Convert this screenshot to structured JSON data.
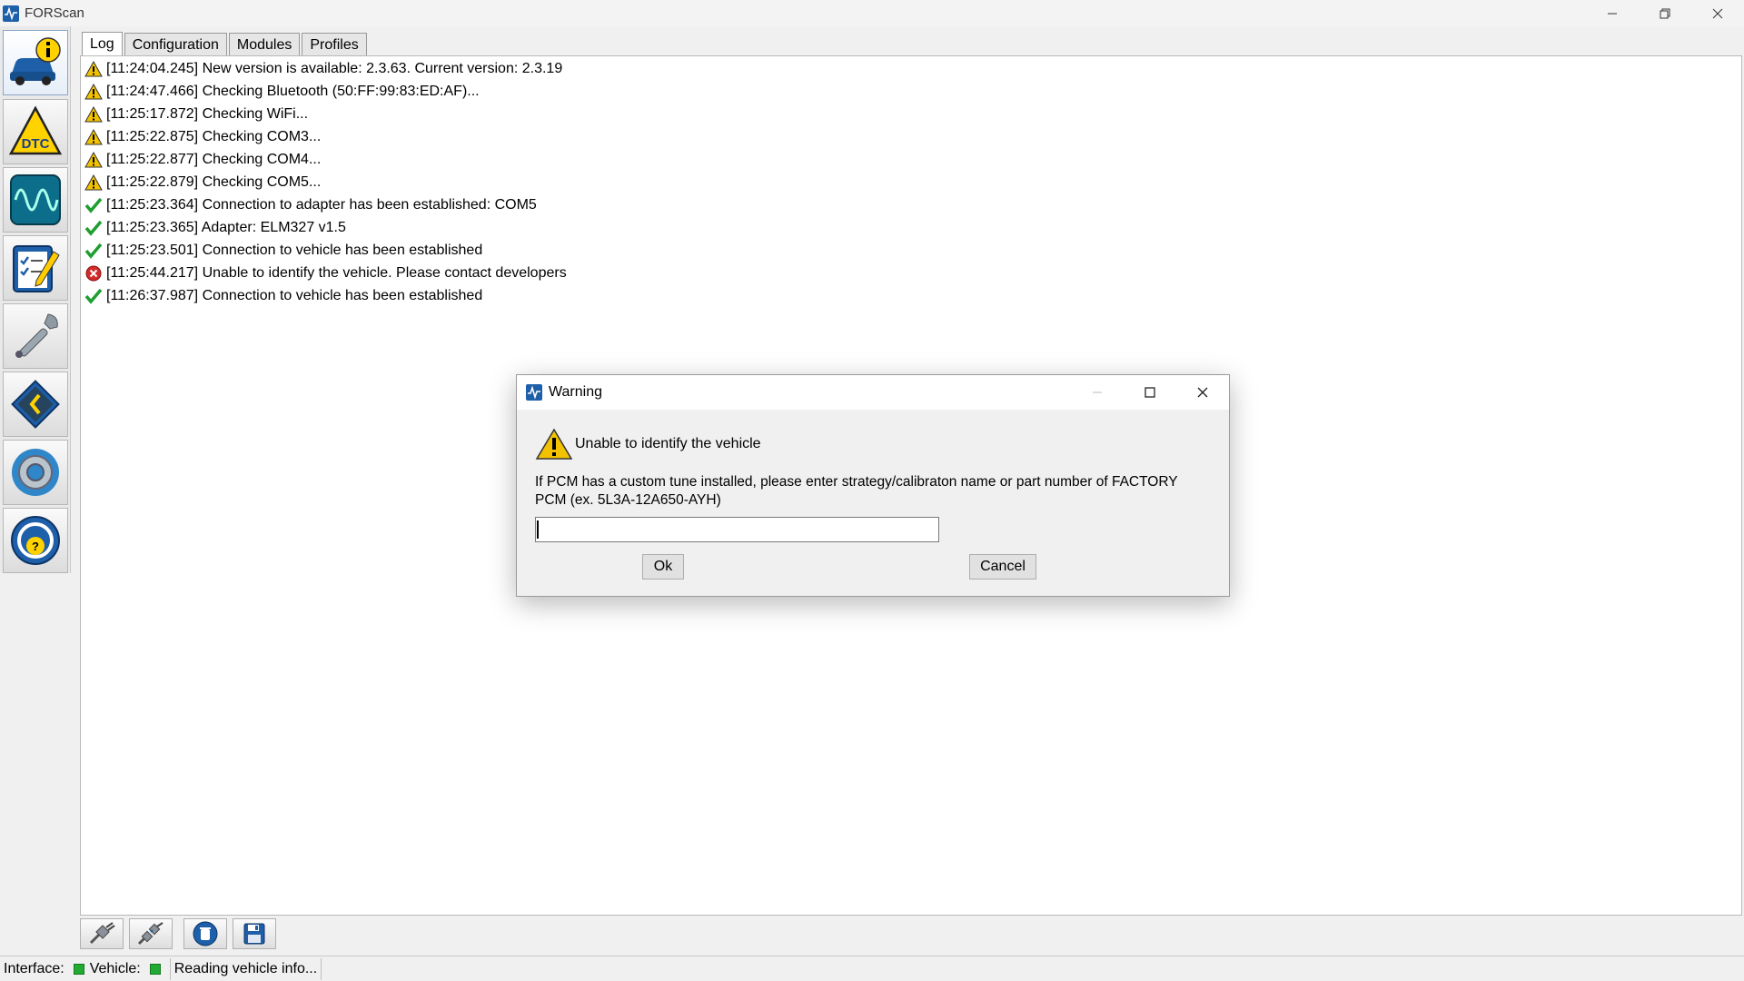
{
  "window": {
    "title": "FORScan",
    "icon": "forscan-app-icon",
    "controls": {
      "minimize": "minimize-icon",
      "restore": "restore-icon",
      "close": "close-icon"
    }
  },
  "sidebar": {
    "items": [
      {
        "name": "vehicle-info",
        "icon": "car-info-icon",
        "active": true
      },
      {
        "name": "dtc",
        "icon": "dtc-warning-icon",
        "label": "DTC"
      },
      {
        "name": "oscilloscope",
        "icon": "oscilloscope-icon"
      },
      {
        "name": "tests",
        "icon": "checklist-icon"
      },
      {
        "name": "service",
        "icon": "wrench-icon"
      },
      {
        "name": "programming",
        "icon": "chip-icon"
      },
      {
        "name": "settings",
        "icon": "gear-icon"
      },
      {
        "name": "help",
        "icon": "help-icon"
      }
    ]
  },
  "tabs": [
    {
      "label": "Log",
      "active": true
    },
    {
      "label": "Configuration"
    },
    {
      "label": "Modules"
    },
    {
      "label": "Profiles"
    }
  ],
  "log": [
    {
      "type": "warning",
      "text": "[11:24:04.245] New version is available: 2.3.63. Current version: 2.3.19"
    },
    {
      "type": "warning",
      "text": "[11:24:47.466] Checking Bluetooth (50:FF:99:83:ED:AF)..."
    },
    {
      "type": "warning",
      "text": "[11:25:17.872] Checking WiFi..."
    },
    {
      "type": "warning",
      "text": "[11:25:22.875] Checking COM3..."
    },
    {
      "type": "warning",
      "text": "[11:25:22.877] Checking COM4..."
    },
    {
      "type": "warning",
      "text": "[11:25:22.879] Checking COM5..."
    },
    {
      "type": "success",
      "text": "[11:25:23.364] Connection to adapter has been established: COM5"
    },
    {
      "type": "success",
      "text": "[11:25:23.365] Adapter:  ELM327 v1.5"
    },
    {
      "type": "success",
      "text": "[11:25:23.501] Connection to vehicle has been established"
    },
    {
      "type": "error",
      "text": "[11:25:44.217] Unable to identify the vehicle. Please contact developers"
    },
    {
      "type": "success",
      "text": "[11:26:37.987] Connection to vehicle has been established"
    }
  ],
  "bottom_tools": [
    {
      "name": "connect",
      "icon": "plug-connect-icon"
    },
    {
      "name": "disconnect",
      "icon": "plug-disconnect-icon"
    },
    {
      "name": "clear-log",
      "icon": "trash-icon"
    },
    {
      "name": "save-log",
      "icon": "floppy-disk-icon"
    }
  ],
  "status": {
    "interface_label": "Interface:",
    "vehicle_label": "Vehicle:",
    "message": "Reading vehicle info...",
    "interface_color": "#22aa33",
    "vehicle_color": "#22aa33"
  },
  "dialog": {
    "title": "Warning",
    "heading": "Unable to identify the vehicle",
    "message": "If PCM has a custom tune installed, please enter strategy/calibraton name or part number of FACTORY PCM (ex. 5L3A-12A650-AYH)",
    "input_value": "",
    "ok_label": "Ok",
    "cancel_label": "Cancel"
  },
  "colors": {
    "warning": "#f2c200",
    "success": "#1e9e2f",
    "error": "#d42a2a",
    "accent": "#1d5fa8"
  }
}
